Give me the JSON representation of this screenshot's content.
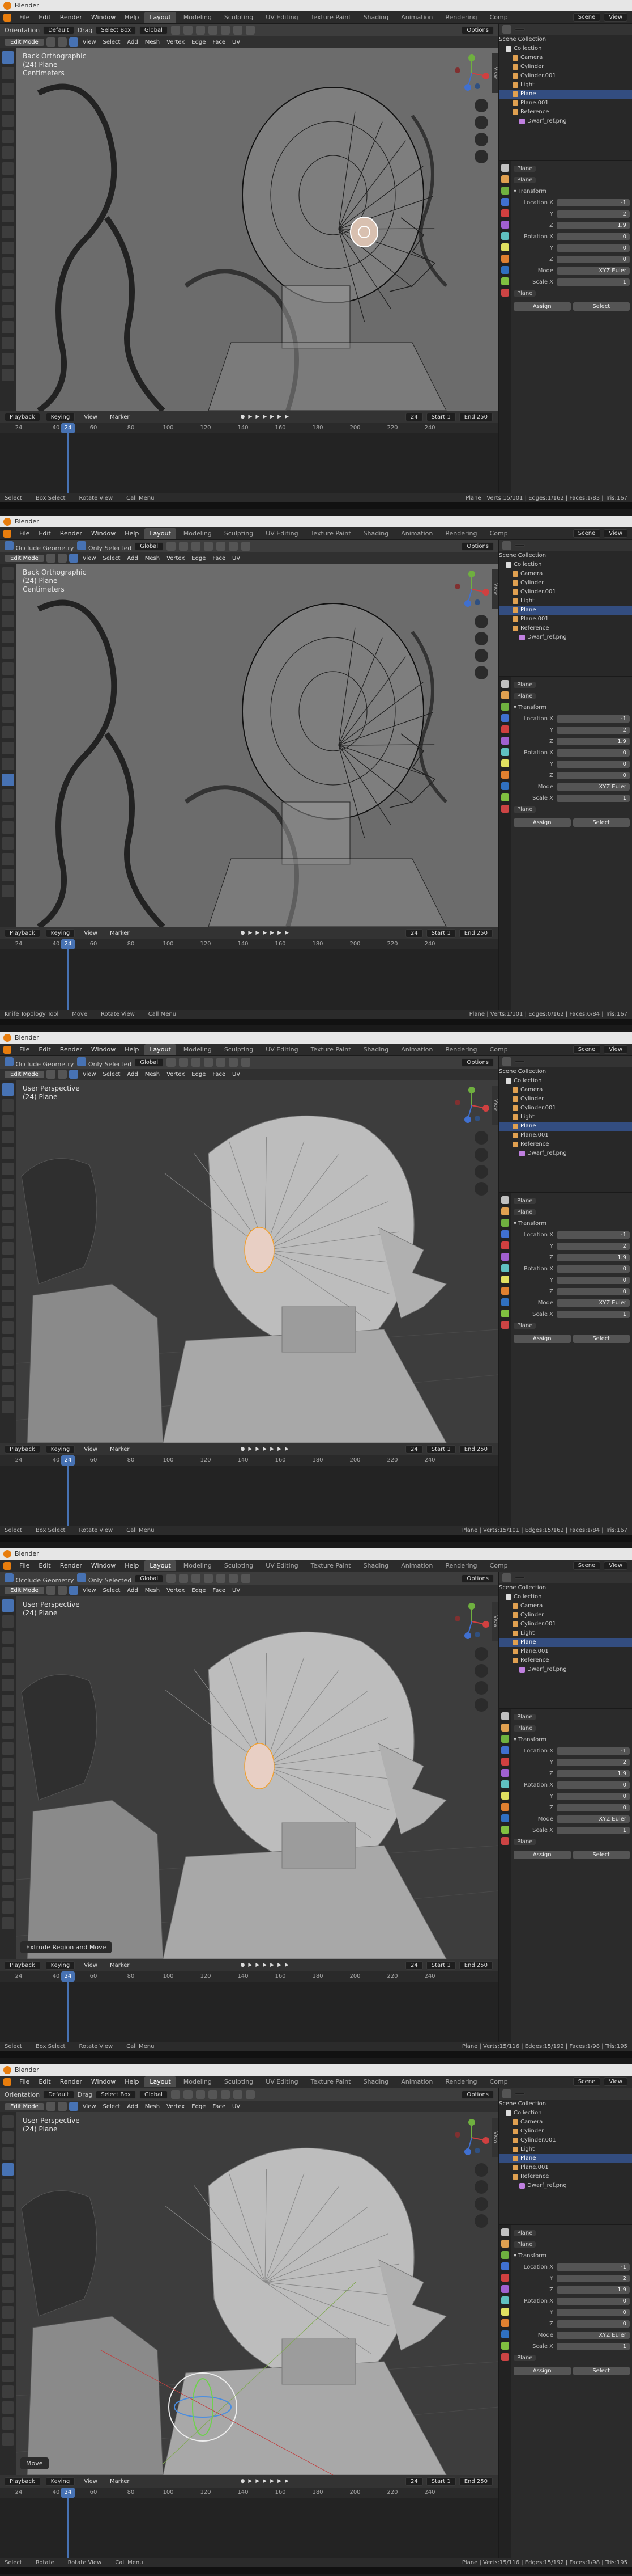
{
  "window_title": "Blender",
  "menus": [
    "File",
    "Edit",
    "Render",
    "Window",
    "Help"
  ],
  "workspace_tabs": [
    "Layout",
    "Modeling",
    "Sculpting",
    "UV Editing",
    "Texture Paint",
    "Shading",
    "Animation",
    "Rendering",
    "Comp"
  ],
  "active_tab": "Layout",
  "scene": "Scene",
  "view_layer": "View",
  "header_tools": {
    "orientation": "Orientation",
    "default": "Default",
    "drag": "Drag",
    "select_box": "Select Box",
    "transform_orientation": "Global",
    "options": "Options",
    "occlude_geometry": "Occlude Geometry",
    "only_selected": "Only Selected"
  },
  "edit_menu": [
    "Edit Mode",
    "View",
    "Select",
    "Add",
    "Mesh",
    "Vertex",
    "Edge",
    "Face",
    "UV"
  ],
  "timeline": {
    "playback": "Playback",
    "keying": "Keying",
    "view": "View",
    "marker": "Marker",
    "current_frame": "24",
    "start_label": "Start",
    "start": "1",
    "end_label": "End",
    "end": "250",
    "ticks": [
      "24",
      "40",
      "60",
      "80",
      "100",
      "120",
      "140",
      "160",
      "180",
      "200",
      "220",
      "240"
    ]
  },
  "outliner": {
    "title": "Scene Collection",
    "items": [
      {
        "name": "Collection",
        "color": "#dddddd",
        "indent": 1
      },
      {
        "name": "Camera",
        "color": "#e0a050",
        "indent": 2
      },
      {
        "name": "Cylinder",
        "color": "#e0a050",
        "indent": 2
      },
      {
        "name": "Cylinder.001",
        "color": "#e0a050",
        "indent": 2
      },
      {
        "name": "Light",
        "color": "#e0a050",
        "indent": 2
      },
      {
        "name": "Plane",
        "color": "#e0a050",
        "indent": 2,
        "selected": true
      },
      {
        "name": "Plane.001",
        "color": "#e0a050",
        "indent": 2
      },
      {
        "name": "Reference",
        "color": "#e0a050",
        "indent": 2
      },
      {
        "name": "Dwarf_ref.png",
        "color": "#c080e0",
        "indent": 3
      }
    ]
  },
  "properties": {
    "object_name": "Plane",
    "mesh_name": "Plane",
    "transform": "Transform",
    "location": "Location X",
    "rotation": "Rotation X",
    "mode": "Mode",
    "mode_value": "XYZ Euler",
    "scale": "Scale X",
    "loc_values": [
      "-1",
      "2",
      "1.9"
    ],
    "rot_values": [
      "0",
      "0",
      "0"
    ],
    "scale_value": "1",
    "assign": "Assign",
    "select": "Select"
  },
  "panels": [
    {
      "view": "Back Orthographic",
      "object": "(24) Plane",
      "extra": "Centimeters",
      "viewport_style": "ref",
      "operator": "",
      "status_left": [
        "Select",
        "Box Select",
        "Rotate View",
        "Call Menu"
      ],
      "stats": "Plane | Verts:15/101 | Edges:1/162 | Faces:1/83 | Tris:167"
    },
    {
      "view": "Back Orthographic",
      "object": "(24) Plane",
      "extra": "Centimeters",
      "viewport_style": "ref",
      "operator": "",
      "status_left": [
        "Knife Topology Tool",
        "Move",
        "Rotate View",
        "Call Menu"
      ],
      "stats": "Plane | Verts:1/101 | Edges:0/162 | Faces:0/84 | Tris:167"
    },
    {
      "view": "User Perspective",
      "object": "(24) Plane",
      "extra": "",
      "viewport_style": "solid",
      "operator": "",
      "status_left": [
        "Select",
        "Box Select",
        "Rotate View",
        "Call Menu"
      ],
      "stats": "Plane | Verts:15/101 | Edges:15/162 | Faces:1/84 | Tris:167"
    },
    {
      "view": "User Perspective",
      "object": "(24) Plane",
      "extra": "",
      "viewport_style": "solid",
      "operator": "Extrude Region and Move",
      "status_left": [
        "Select",
        "Box Select",
        "Rotate View",
        "Call Menu"
      ],
      "stats": "Plane | Verts:15/116 | Edges:15/192 | Faces:1/98 | Tris:195"
    },
    {
      "view": "User Perspective",
      "object": "(24) Plane",
      "extra": "",
      "viewport_style": "solid-rotate",
      "operator": "Move",
      "status_left": [
        "Select",
        "Rotate",
        "Rotate View",
        "Call Menu"
      ],
      "stats": "Plane | Verts:15/116 | Edges:15/192 | Faces:1/98 | Tris:195"
    }
  ]
}
